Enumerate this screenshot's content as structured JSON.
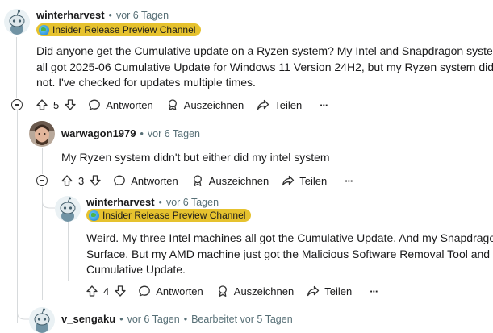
{
  "comments": [
    {
      "username": "winterharvest",
      "time": "vor 6 Tagen",
      "flair": "Insider Release Preview Channel",
      "body_lines": [
        "Did anyone get the Cumulative update on a Ryzen system? My Intel and Snapdragon systems",
        "all got 2025-06 Cumulative Update for Windows 11 Version 24H2, but my Ryzen system did",
        "not. I've checked for updates multiple times."
      ],
      "votes": "5"
    },
    {
      "username": "warwagon1979",
      "time": "vor 6 Tagen",
      "body_lines": [
        "My Ryzen system didn't but either did my intel system"
      ],
      "votes": "3"
    },
    {
      "username": "winterharvest",
      "time": "vor 6 Tagen",
      "flair": "Insider Release Preview Channel",
      "body_lines": [
        "Weird. My three Intel machines all got the Cumulative Update. And my Snapdragon",
        "Surface. But my AMD machine just got the Malicious Software Removal Tool and no",
        "Cumulative Update."
      ],
      "votes": "4"
    },
    {
      "username": "v_sengaku",
      "time": "vor 6 Tagen",
      "edited": "Bearbeitet vor 5 Tagen"
    }
  ],
  "actions": {
    "reply": "Antworten",
    "award": "Auszeichnen",
    "share": "Teilen",
    "more": "···"
  },
  "separator": "•"
}
